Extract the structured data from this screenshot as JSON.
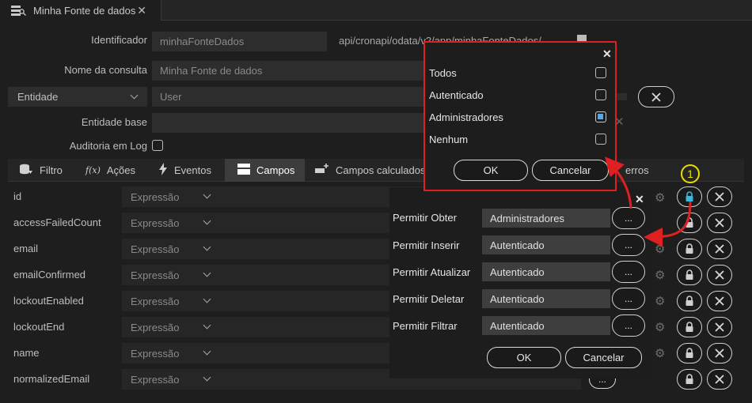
{
  "tab": {
    "title": "Minha Fonte de dados"
  },
  "form": {
    "identificador_label": "Identificador",
    "identificador_value": "minhaFonteDados",
    "url": "api/cronapi/odata/v2/app/minhaFonteDados/",
    "nome_label": "Nome da consulta",
    "nome_value": "Minha Fonte de dados",
    "entidade_select": "Entidade",
    "entidade_value": "User",
    "entidade_base_label": "Entidade base",
    "auditoria_label": "Auditoria em Log"
  },
  "subtabs": [
    {
      "label": "Filtro"
    },
    {
      "label": "Ações"
    },
    {
      "label": "Eventos"
    },
    {
      "label": "Campos"
    },
    {
      "label": "Campos calculados"
    },
    {
      "label": "erros"
    }
  ],
  "rows": [
    {
      "name": "id",
      "type": "Expressão"
    },
    {
      "name": "accessFailedCount",
      "type": "Expressão"
    },
    {
      "name": "email",
      "type": "Expressão"
    },
    {
      "name": "emailConfirmed",
      "type": "Expressão"
    },
    {
      "name": "lockoutEnabled",
      "type": "Expressão"
    },
    {
      "name": "lockoutEnd",
      "type": "Expressão"
    },
    {
      "name": "name",
      "type": "Expressão"
    },
    {
      "name": "normalizedEmail",
      "type": "Expressão"
    }
  ],
  "roles_dialog": {
    "options": [
      {
        "label": "Todos",
        "checked": false
      },
      {
        "label": "Autenticado",
        "checked": false
      },
      {
        "label": "Administradores",
        "checked": true
      },
      {
        "label": "Nenhum",
        "checked": false
      }
    ],
    "ok": "OK",
    "cancel": "Cancelar"
  },
  "perm_dialog": {
    "rows": [
      {
        "label": "Permitir Obter",
        "value": "Administradores"
      },
      {
        "label": "Permitir Inserir",
        "value": "Autenticado"
      },
      {
        "label": "Permitir Atualizar",
        "value": "Autenticado"
      },
      {
        "label": "Permitir Deletar",
        "value": "Autenticado"
      },
      {
        "label": "Permitir Filtrar",
        "value": "Autenticado"
      }
    ],
    "dots": "...",
    "ok": "OK",
    "cancel": "Cancelar"
  },
  "annotation": {
    "step": "1"
  },
  "colors": {
    "accent_red": "#e02020",
    "callout_yellow": "#e8e000",
    "checkbox_blue": "#5aa9e6",
    "lock_active": "#3bb7d9"
  }
}
